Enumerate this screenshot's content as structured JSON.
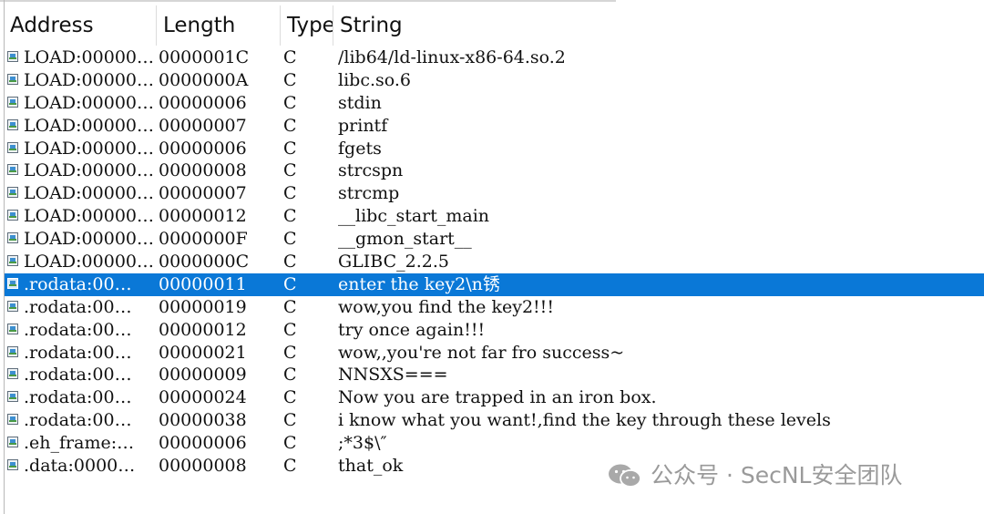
{
  "header": {
    "address": "Address",
    "length": "Length",
    "type": "Type",
    "string": "String"
  },
  "rows": [
    {
      "address": "LOAD:00000…",
      "length": "0000001C",
      "type": "C",
      "string": "/lib64/ld-linux-x86-64.so.2"
    },
    {
      "address": "LOAD:00000…",
      "length": "0000000A",
      "type": "C",
      "string": "libc.so.6"
    },
    {
      "address": "LOAD:00000…",
      "length": "00000006",
      "type": "C",
      "string": "stdin"
    },
    {
      "address": "LOAD:00000…",
      "length": "00000007",
      "type": "C",
      "string": "printf"
    },
    {
      "address": "LOAD:00000…",
      "length": "00000006",
      "type": "C",
      "string": "fgets"
    },
    {
      "address": "LOAD:00000…",
      "length": "00000008",
      "type": "C",
      "string": "strcspn"
    },
    {
      "address": "LOAD:00000…",
      "length": "00000007",
      "type": "C",
      "string": "strcmp"
    },
    {
      "address": "LOAD:00000…",
      "length": "00000012",
      "type": "C",
      "string": "__libc_start_main"
    },
    {
      "address": "LOAD:00000…",
      "length": "0000000F",
      "type": "C",
      "string": "__gmon_start__"
    },
    {
      "address": "LOAD:00000…",
      "length": "0000000C",
      "type": "C",
      "string": "GLIBC_2.2.5"
    },
    {
      "address": ".rodata:00…",
      "length": "00000011",
      "type": "C",
      "string": "enter the key2\\n锈"
    },
    {
      "address": ".rodata:00…",
      "length": "00000019",
      "type": "C",
      "string": "wow,you find the key2!!!"
    },
    {
      "address": ".rodata:00…",
      "length": "00000012",
      "type": "C",
      "string": "try once again!!!"
    },
    {
      "address": ".rodata:00…",
      "length": "00000021",
      "type": "C",
      "string": "wow,,you're not far fro success~"
    },
    {
      "address": ".rodata:00…",
      "length": "00000009",
      "type": "C",
      "string": "NNSXS==="
    },
    {
      "address": ".rodata:00…",
      "length": "00000024",
      "type": "C",
      "string": "Now you are trapped in an iron box."
    },
    {
      "address": ".rodata:00…",
      "length": "00000038",
      "type": "C",
      "string": "i know what you want!,find the key through these levels"
    },
    {
      "address": ".eh_frame:…",
      "length": "00000006",
      "type": "C",
      "string": ";*3$\\″"
    },
    {
      "address": ".data:0000…",
      "length": "00000008",
      "type": "C",
      "string": "that_ok"
    }
  ],
  "selected_row_index": 10,
  "colors": {
    "selection": "#0a78d7",
    "watermark": "#9a9a9a"
  },
  "icons": {
    "row": "string-item-icon",
    "watermark": "wechat-icon"
  },
  "watermark": {
    "text": "公众号 · SecNL安全团队"
  }
}
